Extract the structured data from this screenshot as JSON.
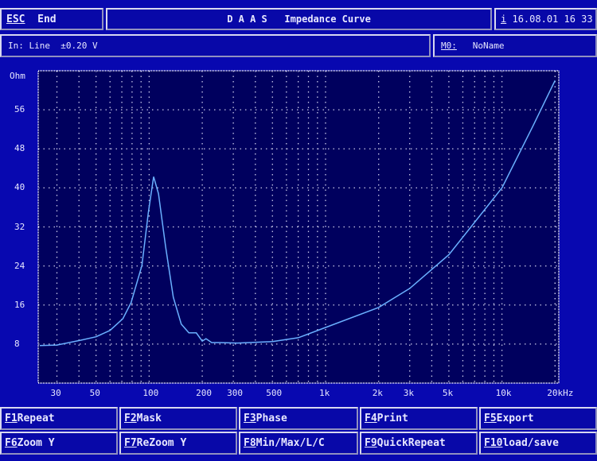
{
  "header": {
    "esc_key": "ESC",
    "esc_label": "End",
    "title": "D A A S   Impedance Curve",
    "info_key": "i",
    "datetime": "16.08.01 16 33"
  },
  "status": {
    "input": "In: Line  ±0.20 V",
    "memory_key": "M0:",
    "memory_name": "NoName"
  },
  "function_keys": [
    {
      "key": "F1",
      "label": "Repeat"
    },
    {
      "key": "F2",
      "label": "Mask"
    },
    {
      "key": "F3",
      "label": "Phase"
    },
    {
      "key": "F4",
      "label": "Print"
    },
    {
      "key": "F5",
      "label": "Export"
    },
    {
      "key": "F6",
      "label": "Zoom Y"
    },
    {
      "key": "F7",
      "label": "ReZoom Y"
    },
    {
      "key": "F8",
      "label": "Min/Max/L/C"
    },
    {
      "key": "F9",
      "label": "QuickRepeat"
    },
    {
      "key": "F10",
      "label": "load/save"
    }
  ],
  "colors": {
    "background": "#0808b0",
    "plot_background": "#00005e",
    "curve": "#6ab0ff",
    "grid": "#c8c8e8"
  },
  "chart_data": {
    "type": "line",
    "title": "",
    "xlabel": "Hz",
    "ylabel": "Ohm",
    "x_scale": "log",
    "xlim": [
      23.5,
      21000
    ],
    "ylim": [
      0,
      64
    ],
    "grid": true,
    "y_ticks": [
      8,
      16,
      24,
      32,
      40,
      48,
      56
    ],
    "y_tick_labels": [
      "8",
      "16",
      "24",
      "32",
      "40",
      "48",
      "56"
    ],
    "x_ticks": [
      30,
      50,
      100,
      200,
      300,
      500,
      1000,
      2000,
      3000,
      5000,
      10000,
      20000
    ],
    "x_tick_labels": [
      "30",
      "50",
      "100",
      "200",
      "300",
      "500",
      "1k",
      "2k",
      "3k",
      "5k",
      "10k",
      "20kHz"
    ],
    "series": [
      {
        "x": [
          24,
          30,
          41,
          50,
          60,
          71,
          79,
          91,
          99,
          106,
          113,
          124,
          137,
          152,
          168,
          185,
          200,
          210,
          226,
          250,
          317,
          500,
          700,
          1000,
          2000,
          3000,
          5000,
          10000,
          15000,
          20000
        ],
        "y": [
          7.7,
          7.8,
          8.8,
          9.5,
          10.8,
          13.2,
          16.5,
          24.1,
          35,
          42.3,
          38.8,
          27.9,
          17.6,
          12.1,
          10.3,
          10.3,
          8.6,
          9.1,
          8.3,
          8.3,
          8.2,
          8.5,
          9.3,
          11.4,
          15.5,
          19.4,
          26.3,
          40,
          52.7,
          62
        ]
      }
    ]
  }
}
